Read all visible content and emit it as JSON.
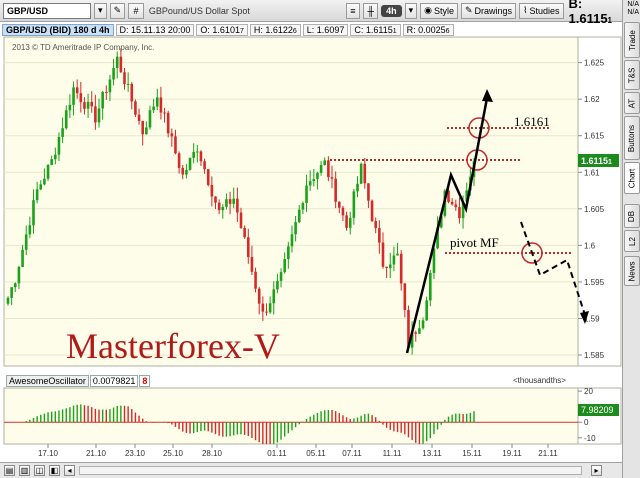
{
  "toolbar": {
    "symbol": "GBP/USD",
    "description": "GBPound/US Dollar Spot",
    "timeframe": "4h",
    "style_label": "Style",
    "drawings_label": "Drawings",
    "studies_label": "Studies",
    "bid_label": "B:",
    "bid_value": "1.6115",
    "bid_small": "1"
  },
  "infobar": {
    "title": "GBP/USD (BID) 180 d 4h",
    "date": "D: 15.11.13 20:00",
    "open": "O: 1.6101",
    "open_small": "7",
    "high": "H: 1.6122",
    "high_small": "6",
    "low": "L: 1.6097",
    "close": "C: 1.6115",
    "close_small": "1",
    "range": "R: 0.0025",
    "range_small": "6"
  },
  "sidebar": {
    "na_top": "N/A",
    "na_bottom": "N/A",
    "tabs": [
      "Trade",
      "T&S",
      "AT",
      "Buttons",
      "Chart",
      "DB",
      "L2",
      "News"
    ]
  },
  "chart": {
    "watermark": "2013 © TD Ameritrade IP Company, Inc.",
    "annotation_text": "Masterforex-V",
    "label_level": "1.6161",
    "label_pivot": "pivot MF",
    "price_badge": "1.6115",
    "price_badge_small": "1",
    "y_ticks": [
      "1.625",
      "1.62",
      "1.615",
      "1.61",
      "1.605",
      "1.6",
      "1.595",
      "1.59",
      "1.585"
    ],
    "x_ticks": [
      "17.10",
      "21.10",
      "23.10",
      "25.10",
      "28.10",
      "01.11",
      "05.11",
      "07.11",
      "11.11",
      "13.11",
      "15.11",
      "19.11",
      "21.11"
    ]
  },
  "chart_data": {
    "type": "candlestick",
    "title": "GBP/USD (BID) 180 d 4h",
    "ylim": [
      1.5835,
      1.6285
    ],
    "y_ticks": [
      1.625,
      1.62,
      1.615,
      1.61,
      1.605,
      1.6,
      1.595,
      1.59,
      1.585
    ],
    "x_tick_labels": [
      "17.10",
      "21.10",
      "23.10",
      "25.10",
      "28.10",
      "01.11",
      "05.11",
      "07.11",
      "11.11",
      "13.11",
      "15.11",
      "19.11",
      "21.11"
    ],
    "colors": {
      "up": "#1aa31a",
      "down": "#d42a2a"
    },
    "last_price": 1.61151,
    "segments": [
      {
        "from": 1.5915,
        "to": 1.5955,
        "bars": 3
      },
      {
        "from": 1.5955,
        "to": 1.6075,
        "bars": 6
      },
      {
        "from": 1.6075,
        "to": 1.6115,
        "bars": 4
      },
      {
        "from": 1.6115,
        "to": 1.6215,
        "bars": 6
      },
      {
        "from": 1.6215,
        "to": 1.6175,
        "bars": 6
      },
      {
        "from": 1.6175,
        "to": 1.6255,
        "bars": 6
      },
      {
        "from": 1.6255,
        "to": 1.6155,
        "bars": 7
      },
      {
        "from": 1.6155,
        "to": 1.6205,
        "bars": 4
      },
      {
        "from": 1.6205,
        "to": 1.6095,
        "bars": 7
      },
      {
        "from": 1.6095,
        "to": 1.6135,
        "bars": 4
      },
      {
        "from": 1.6135,
        "to": 1.6045,
        "bars": 6
      },
      {
        "from": 1.6045,
        "to": 1.6065,
        "bars": 4
      },
      {
        "from": 1.6065,
        "to": 1.5905,
        "bars": 8
      },
      {
        "from": 1.5905,
        "to": 1.5955,
        "bars": 5
      },
      {
        "from": 1.5955,
        "to": 1.6085,
        "bars": 7
      },
      {
        "from": 1.6085,
        "to": 1.6112,
        "bars": 5
      },
      {
        "from": 1.6112,
        "to": 1.6025,
        "bars": 6
      },
      {
        "from": 1.6025,
        "to": 1.6105,
        "bars": 4
      },
      {
        "from": 1.6105,
        "to": 1.5975,
        "bars": 6
      },
      {
        "from": 1.5975,
        "to": 1.5985,
        "bars": 4
      },
      {
        "from": 1.5985,
        "to": 1.5865,
        "bars": 3
      },
      {
        "from": 1.5865,
        "to": 1.5905,
        "bars": 4
      },
      {
        "from": 1.5905,
        "to": 1.6075,
        "bars": 6
      },
      {
        "from": 1.6075,
        "to": 1.6045,
        "bars": 4
      },
      {
        "from": 1.6045,
        "to": 1.6115,
        "bars": 4
      }
    ],
    "drawn_lines": {
      "resistance_level": 1.6115,
      "level_1_6161": 1.6161,
      "pivot_level": 1.599
    }
  },
  "oscillator": {
    "name": "AwesomeOscillator",
    "value": "0.0079821",
    "close_glyph": "8",
    "units": "<thousandths>",
    "value_badge": "7.98209",
    "y_ticks": [
      "20",
      "0",
      "-10"
    ],
    "ylim": [
      -14,
      22
    ]
  }
}
